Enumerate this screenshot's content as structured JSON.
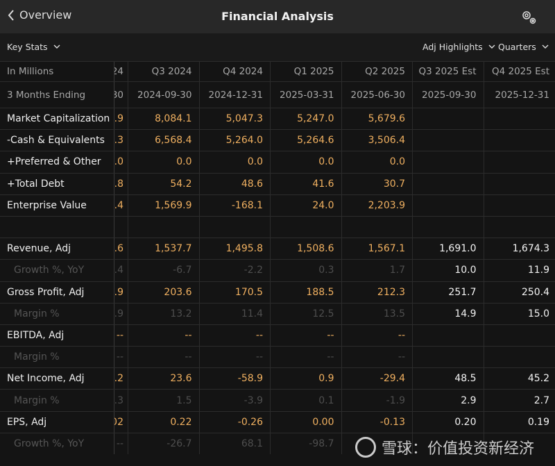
{
  "header": {
    "back_label": "Overview",
    "title": "Financial Analysis"
  },
  "toolbar": {
    "key_stats": "Key Stats",
    "adj_highlights": "Adj Highlights",
    "quarters": "Quarters"
  },
  "table": {
    "header_label": "In Millions",
    "date_label": "3 Months Ending",
    "columns": [
      "24",
      "Q3 2024",
      "Q4 2024",
      "Q1 2025",
      "Q2 2025",
      "Q3 2025 Est",
      "Q4 2025 Est"
    ],
    "dates": [
      "30",
      "2024-09-30",
      "2024-12-31",
      "2025-03-31",
      "2025-06-30",
      "2025-09-30",
      "2025-12-31"
    ],
    "rows": [
      {
        "label": "Market Capitalization",
        "type": "main",
        "values": [
          ".9",
          "8,084.1",
          "5,047.3",
          "5,247.0",
          "5,679.6",
          "",
          ""
        ]
      },
      {
        "label": "-Cash & Equivalents",
        "type": "main",
        "values": [
          ".3",
          "6,568.4",
          "5,264.0",
          "5,264.6",
          "3,506.4",
          "",
          ""
        ]
      },
      {
        "label": "+Preferred & Other",
        "type": "main",
        "values": [
          ".0",
          "0.0",
          "0.0",
          "0.0",
          "0.0",
          "",
          ""
        ]
      },
      {
        "label": "+Total Debt",
        "type": "main",
        "values": [
          ".8",
          "54.2",
          "48.6",
          "41.6",
          "30.7",
          "",
          ""
        ]
      },
      {
        "label": "Enterprise Value",
        "type": "main",
        "values": [
          ".4",
          "1,569.9",
          "-168.1",
          "24.0",
          "2,203.9",
          "",
          ""
        ]
      },
      {
        "label": "",
        "type": "blank",
        "values": [
          "",
          "",
          "",
          "",
          "",
          "",
          ""
        ]
      },
      {
        "label": "Revenue, Adj",
        "type": "main",
        "values": [
          ".6",
          "1,537.7",
          "1,495.8",
          "1,508.6",
          "1,567.1",
          "1,691.0",
          "1,674.3"
        ]
      },
      {
        "label": "Growth %, YoY",
        "type": "subr",
        "values": [
          ".4",
          "-6.7",
          "-2.2",
          "0.3",
          "1.7",
          "10.0",
          "11.9"
        ]
      },
      {
        "label": "Gross Profit, Adj",
        "type": "main",
        "values": [
          ".9",
          "203.6",
          "170.5",
          "188.5",
          "212.3",
          "251.7",
          "250.4"
        ]
      },
      {
        "label": "Margin %",
        "type": "subr",
        "values": [
          ".9",
          "13.2",
          "11.4",
          "12.5",
          "13.5",
          "14.9",
          "15.0"
        ]
      },
      {
        "label": "EBITDA, Adj",
        "type": "main",
        "values": [
          "--",
          "--",
          "--",
          "--",
          "--",
          "",
          ""
        ]
      },
      {
        "label": "Margin %",
        "type": "subr",
        "values": [
          "--",
          "--",
          "--",
          "--",
          "--",
          "",
          ""
        ]
      },
      {
        "label": "Net Income, Adj",
        "type": "main",
        "values": [
          ".2",
          "23.6",
          "-58.9",
          "0.9",
          "-29.4",
          "48.5",
          "45.2"
        ]
      },
      {
        "label": "Margin %",
        "type": "subr",
        "values": [
          ".3",
          "1.5",
          "-3.9",
          "0.1",
          "-1.9",
          "2.9",
          "2.7"
        ]
      },
      {
        "label": "EPS, Adj",
        "type": "main",
        "values": [
          "02",
          "0.22",
          "-0.26",
          "0.00",
          "-0.13",
          "0.20",
          "0.19"
        ]
      },
      {
        "label": "Growth %, YoY",
        "type": "subr",
        "values": [
          "--",
          "-26.7",
          "68.1",
          "-98.7",
          "",
          "",
          ""
        ]
      }
    ]
  },
  "watermark": {
    "text": "雪球：价值投资新经济"
  }
}
